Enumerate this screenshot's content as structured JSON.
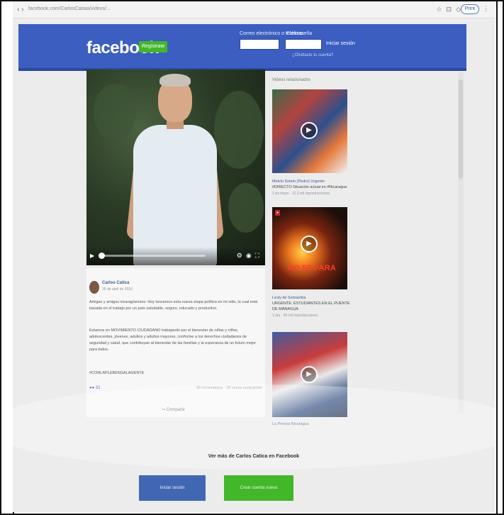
{
  "browser": {
    "url": "facebook.com/CarlosCatiaa/videos/...",
    "print_label": "Print"
  },
  "header": {
    "logo": "facebook",
    "signup_label": "Regístrate",
    "email_label": "Correo electrónico o teléfono",
    "password_label": "Contraseña",
    "login_label": "Iniciar sesión",
    "forgot_label": "¿Olvidaste tu cuenta?",
    "brand_color": "#3b5ec0"
  },
  "video": {
    "progress_fraction": 0.02
  },
  "post": {
    "author": "Carlos Catica",
    "date": "30 de abril de 2018",
    "paragraphs": [
      "Amigas y amigos nicaragüenses: Hoy lanzamos esta nueva etapa política en mi vida, la cual está basada en el trabajo por un país saludable, seguro, educado y productivo.",
      "Estamos en MOVIMIENTO CIUDADANO trabajando por el bienestar de niñas y niños, adolescentes, jóvenes, adultos y adultos mayores, conforme a los derechos ciudadanos de seguridad y salud, que contribuyan al bienestar de las familias y la esperanza de un futuro mejor para todos.",
      "#CONLAPLEBENGALAGENTE"
    ],
    "reactions": "31",
    "comments": "30 comentarios · 28 veces compartido",
    "share_label": "Compartir"
  },
  "sidebar": {
    "title": "Videos relacionados",
    "items": [
      {
        "title": "Melvin Sotelo (Pedro) Urgente",
        "subtitle": "#DIRECTO Situación actual en #Nicaragua",
        "meta": "1 de mayo · 12.3 mil reproducciones"
      },
      {
        "title": "Lesly de Somarriba",
        "subtitle": "URGENTE: ESTUDIANTES EN EL PUENTE DE MANAGUA",
        "meta": "1 día · 46 mil reproducciones",
        "overlay": "NO SE PARA"
      },
      {
        "title": "La Prensa Nicaragua",
        "subtitle": "",
        "meta": ""
      }
    ]
  },
  "footer": {
    "see_more": "Ver más de Carlos Catica en Facebook",
    "login_label": "Iniciar sesión",
    "create_label": "Crear cuenta nueva",
    "login_color": "#4267b2",
    "create_color": "#42b72a"
  }
}
